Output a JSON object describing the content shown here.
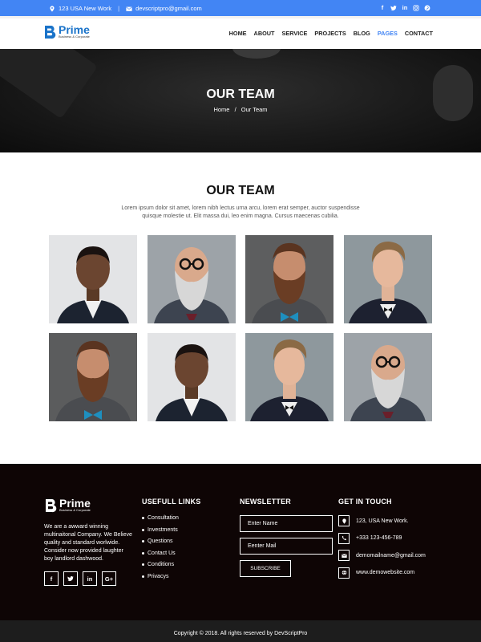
{
  "topbar": {
    "address": "123 USA New Work",
    "email": "devscriptpro@gmail.com",
    "social": [
      "f",
      "t",
      "in",
      "ig",
      "p"
    ]
  },
  "header": {
    "brand": "Prime",
    "tagline": "Business & Corporate",
    "nav": [
      "HOME",
      "ABOUT",
      "SERVICE",
      "PROJECTS",
      "BLOG",
      "PAGES",
      "CONTACT"
    ],
    "active_nav": "PAGES"
  },
  "hero": {
    "title": "OUR TEAM",
    "crumb_home": "Home",
    "crumb_sep": "/",
    "crumb_current": "Our Team"
  },
  "team": {
    "title": "OUR TEAM",
    "description": "Lorem ipsum dolor sit amet, lorem nibh lectus urna arcu, lorem erat semper, auctor suspendisse quisque molestie ut. Elit massa dui, leo enim magna. Cursus maecenas cubilia.",
    "members": [
      "portrait-1",
      "portrait-2",
      "portrait-3",
      "portrait-4",
      "portrait-5",
      "portrait-6",
      "portrait-7",
      "portrait-8"
    ]
  },
  "footer": {
    "brand": "Prime",
    "tagline": "Business & Corporate",
    "about": "We are a awward winning multinaitonal Company. We Believe quality and standard worlwide. Consider now provided laughter boy landlord dashwood.",
    "social": [
      "f",
      "t",
      "in",
      "G+"
    ],
    "links_title": "USEFULL LINKS",
    "links": [
      "Consultation",
      "Investments",
      "Questions",
      "Contact Us",
      "Conditions",
      "Privacys"
    ],
    "newsletter_title": "NEWSLETTER",
    "name_placeholder": "Enter Name",
    "mail_placeholder": "Eenter Mail",
    "subscribe_label": "SUBSCRIBE",
    "touch_title": "GET IN TOUCH",
    "address": "123, USA New Work.",
    "phone": "+333 123-456-789",
    "email": "demomailname@gmail.com",
    "website": "www.demowebsite.com"
  },
  "copyright": "Copyright © 2018. All rights reserved by DevScriptPro",
  "colors": {
    "accent": "#4285f4",
    "footer_bg": "#0e0505",
    "copyright_bg": "#1d1d1d"
  }
}
